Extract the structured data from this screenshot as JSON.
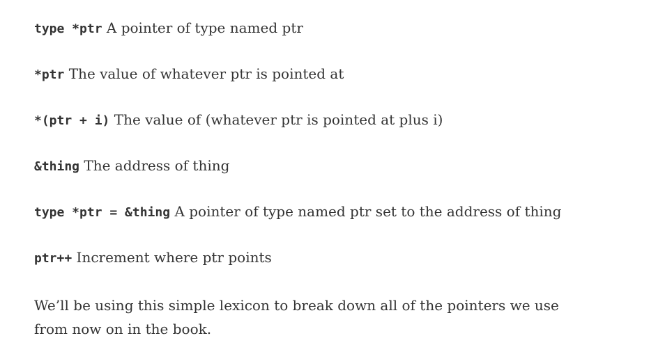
{
  "lexicon": [
    {
      "code": "type *ptr",
      "desc": "A pointer of type named ptr"
    },
    {
      "code": "*ptr",
      "desc": "The value of whatever ptr is pointed at"
    },
    {
      "code": "*(ptr + i)",
      "desc": "The value of (whatever ptr is pointed at plus i)"
    },
    {
      "code": "&thing",
      "desc": "The address of thing"
    },
    {
      "code": "type *ptr = &thing",
      "desc": "A pointer of type named ptr set to the address of thing"
    },
    {
      "code": "ptr++",
      "desc": "Increment where ptr points"
    }
  ],
  "closing_paragraph": "We’ll be using this simple lexicon to break down all of the pointers we use from now on in the book."
}
